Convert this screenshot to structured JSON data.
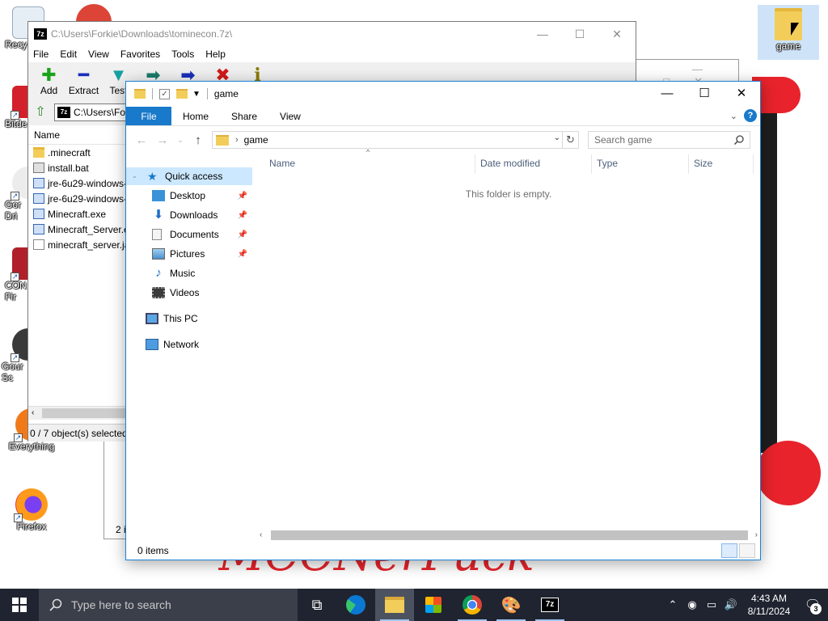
{
  "desktop": {
    "icons": [
      {
        "label": "Recy",
        "icon": "recycle-bin-icon"
      },
      {
        "label": "Bitde",
        "icon": "bitdefender-icon"
      },
      {
        "label": "Gor Dri",
        "icon": "google-drive-icon"
      },
      {
        "label": "CON Fir",
        "icon": "app-shortcut-icon"
      },
      {
        "label": "Gour Sc",
        "icon": "app-shortcut-icon"
      },
      {
        "label": "Everything",
        "icon": "everything-search-icon"
      },
      {
        "label": "Firefox",
        "icon": "firefox-icon"
      },
      {
        "label": "game",
        "icon": "folder-icon"
      }
    ],
    "background_text": "MCCNerPuck",
    "accent_color": "#e8232b"
  },
  "back_window": {
    "status_fragment": "2 i"
  },
  "sevenzip": {
    "title": "C:\\Users\\Forkie\\Downloads\\tominecon.7z\\",
    "app_badge": "7z",
    "menu": [
      "File",
      "Edit",
      "View",
      "Favorites",
      "Tools",
      "Help"
    ],
    "toolbar": [
      {
        "label": "Add",
        "icon": "add-icon",
        "color": "#1aa31a"
      },
      {
        "label": "Extract",
        "icon": "extract-icon",
        "color": "#1b2fb8"
      },
      {
        "label": "Test",
        "icon": "test-icon",
        "color": "#18a0a0"
      },
      {
        "label": "",
        "icon": "copy-icon",
        "color": "#1b7a6a"
      },
      {
        "label": "",
        "icon": "move-icon",
        "color": "#1b2fb8"
      },
      {
        "label": "",
        "icon": "delete-icon",
        "color": "#d11a1a"
      },
      {
        "label": "",
        "icon": "info-icon",
        "color": "#8a7a00"
      }
    ],
    "address": "C:\\Users\\Forki",
    "column_name": "Name",
    "files": [
      {
        "name": ".minecraft",
        "kind": "folder"
      },
      {
        "name": "install.bat",
        "kind": "bat"
      },
      {
        "name": "jre-6u29-windows-",
        "kind": "exe"
      },
      {
        "name": "jre-6u29-windows-",
        "kind": "exe"
      },
      {
        "name": "Minecraft.exe",
        "kind": "exe"
      },
      {
        "name": "Minecraft_Server.e",
        "kind": "exe"
      },
      {
        "name": "minecraft_server.ja",
        "kind": "jar"
      }
    ],
    "status": "0 / 7 object(s) selected"
  },
  "explorer": {
    "title": "game",
    "ribbon_tabs": [
      "File",
      "Home",
      "Share",
      "View"
    ],
    "breadcrumb": "game",
    "search_placeholder": "Search game",
    "nav": {
      "quick_access": "Quick access",
      "pinned": [
        "Desktop",
        "Downloads",
        "Documents",
        "Pictures"
      ],
      "unpinned": [
        "Music",
        "Videos"
      ],
      "this_pc": "This PC",
      "network": "Network"
    },
    "columns": [
      "Name",
      "Date modified",
      "Type",
      "Size"
    ],
    "empty_message": "This folder is empty.",
    "status": "0 items",
    "accent_color": "#1979ca"
  },
  "taskbar": {
    "search_placeholder": "Type here to search",
    "apps": [
      "task-view-icon",
      "edge-icon",
      "file-explorer-icon",
      "store-icon",
      "chrome-icon",
      "paint-icon",
      "7zip-icon"
    ],
    "time": "4:43 AM",
    "date": "8/11/2024",
    "notification_count": "3"
  }
}
